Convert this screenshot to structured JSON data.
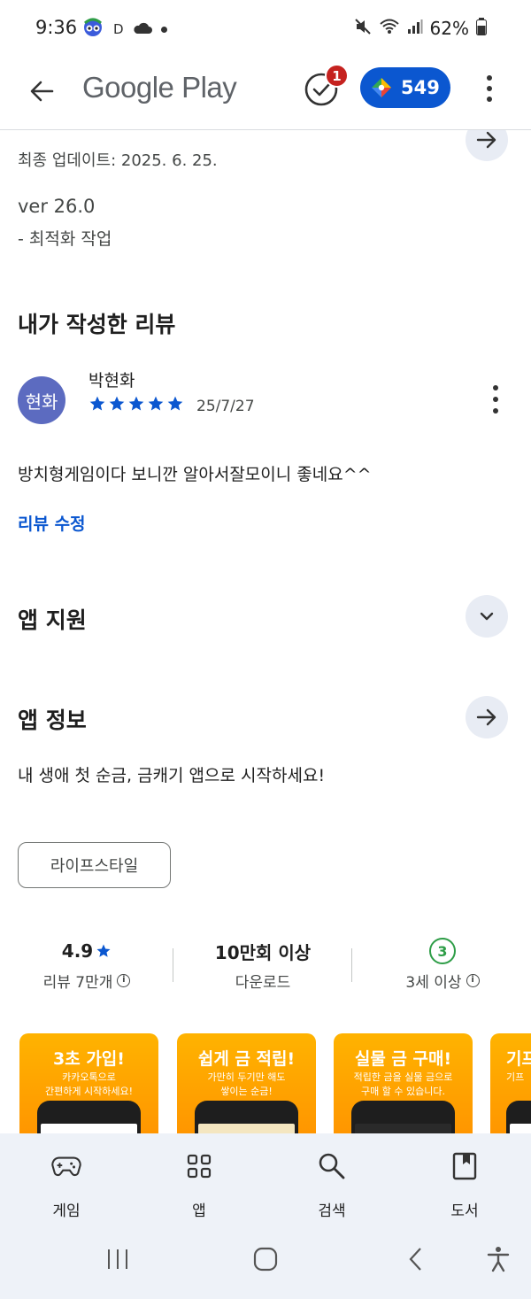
{
  "status_bar": {
    "time": "9:36",
    "indicator": "D",
    "battery": "62%"
  },
  "header": {
    "brand": "Google Play",
    "notification_count": "1",
    "points": "549"
  },
  "whats_new": {
    "updated": "최종 업데이트: 2025. 6. 25.",
    "version": "ver 26.0",
    "note": "- 최적화 작업"
  },
  "my_review": {
    "heading": "내가 작성한 리뷰",
    "avatar_text": "현화",
    "reviewer": "박현화",
    "rating": 5,
    "date": "25/7/27",
    "text": "방치형게임이다 보니깐 알아서잘모이니 좋네요^^",
    "edit_label": "리뷰 수정"
  },
  "support": {
    "heading": "앱 지원"
  },
  "app_info": {
    "heading": "앱 정보",
    "description": "내 생애 첫 순금, 금캐기 앱으로 시작하세요!",
    "category": "라이프스타일"
  },
  "stats": {
    "rating_value": "4.9",
    "rating_label": "리뷰 7만개",
    "downloads_value": "10만회 이상",
    "downloads_label": "다운로드",
    "age_value": "3",
    "age_label": "3세 이상"
  },
  "screenshots": [
    {
      "title": "3초 가입!",
      "subtitle": "카카오톡으로\n간편하게 시작하세요!"
    },
    {
      "title": "쉽게 금 적립!",
      "subtitle": "가만히 두기만 해도\n쌓이는 순금!"
    },
    {
      "title": "실물 금 구매!",
      "subtitle": "적립한 금을 실물 금으로\n구매 할 수 있습니다."
    },
    {
      "title": "기프",
      "subtitle": "기프"
    }
  ],
  "bottom_nav": [
    {
      "label": "게임",
      "icon": "gamepad-icon"
    },
    {
      "label": "앱",
      "icon": "apps-grid-icon"
    },
    {
      "label": "검색",
      "icon": "search-icon"
    },
    {
      "label": "도서",
      "icon": "book-icon"
    }
  ],
  "colors": {
    "accent": "#0b57d0",
    "badge_red": "#c5221f",
    "star_blue": "#0b57d0",
    "age_green": "#2e9d47",
    "nav_bg": "#eef2f8"
  }
}
